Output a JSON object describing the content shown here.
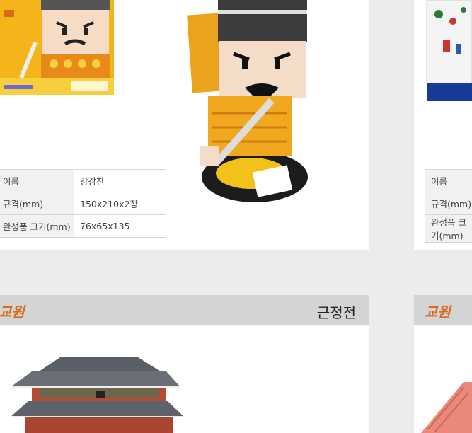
{
  "top_left_product": {
    "spec_rows": [
      {
        "label": "이름",
        "value": "강감찬"
      },
      {
        "label": "규격(mm)",
        "value": "150x210x2장"
      },
      {
        "label": "완성품 크기(mm)",
        "value": "76x65x135"
      }
    ],
    "image_alt": "Gang Gam-chan paper figure"
  },
  "top_right_product": {
    "spec_rows": [
      {
        "label": "이름"
      },
      {
        "label": "규격(mm)"
      },
      {
        "label": "완성품 크기(mm)"
      }
    ]
  },
  "bottom_left_product": {
    "brand": "교원",
    "title": "근정전"
  },
  "bottom_right_product": {
    "brand": "교원"
  },
  "colors": {
    "brand_orange": "#d86a1c",
    "bar_gray": "#d4d4d4",
    "page_bg": "#ececec"
  }
}
